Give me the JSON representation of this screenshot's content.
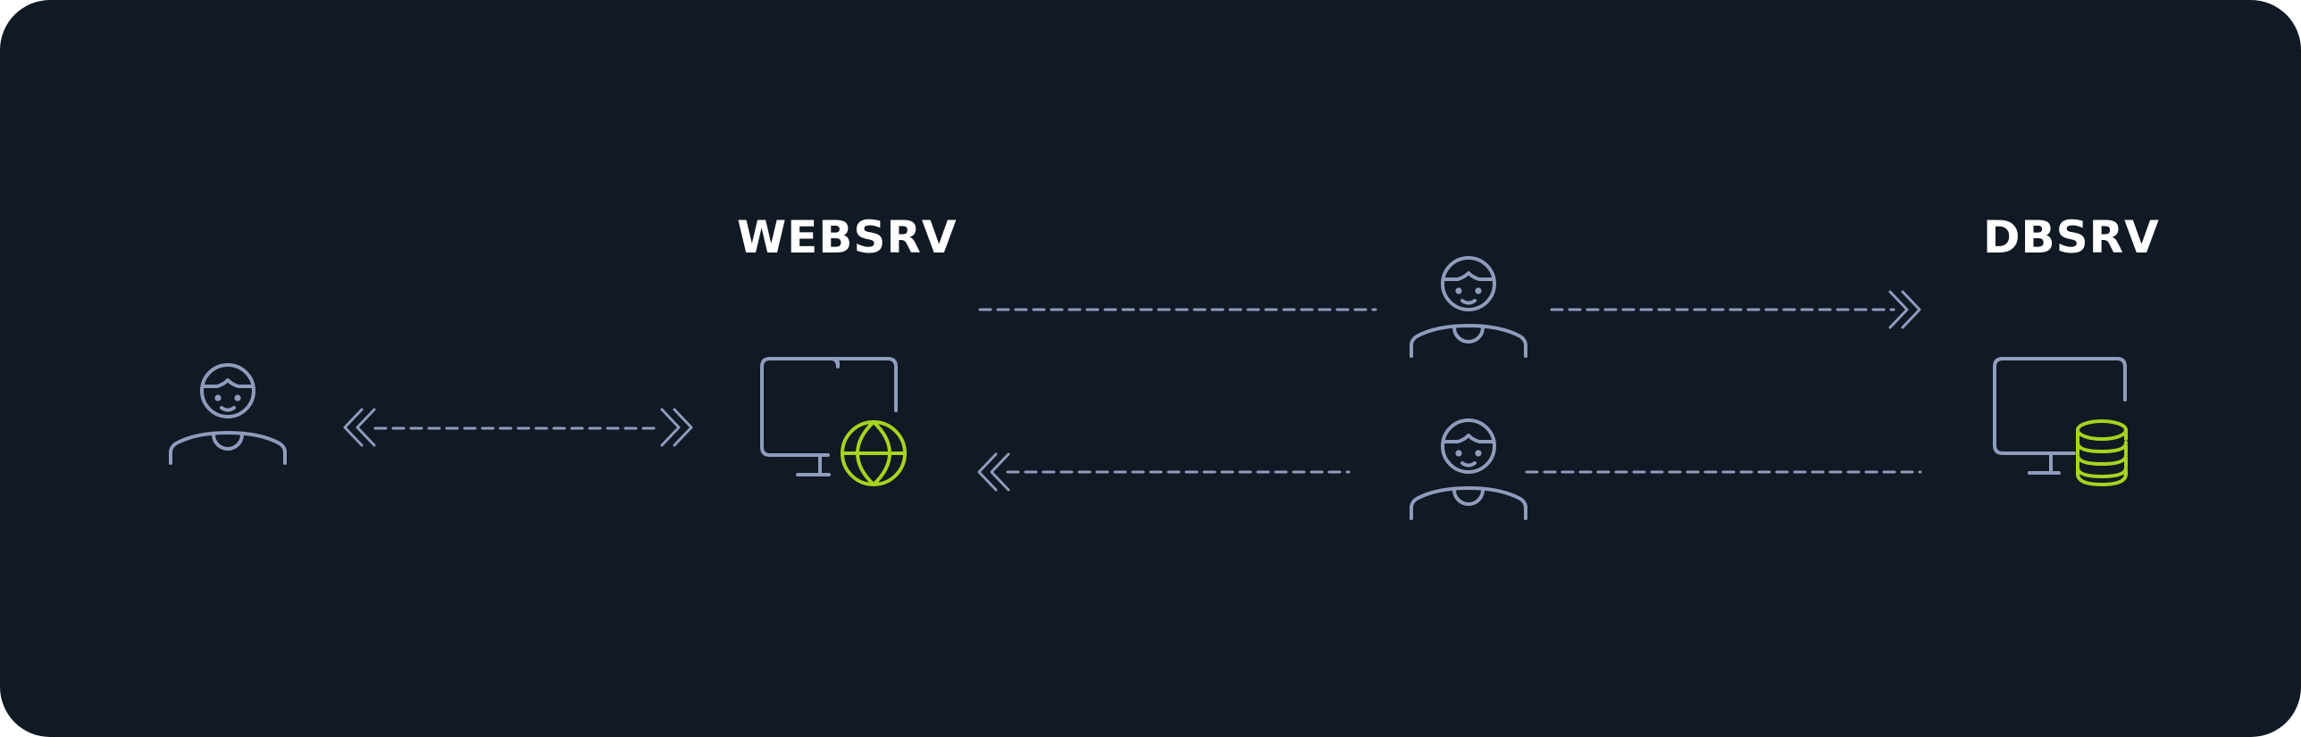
{
  "diagram": {
    "labels": {
      "web_server": "WEBSRV",
      "db_server": "DBSRV"
    },
    "icons": {
      "client": "person-icon",
      "attacker_top": "person-icon",
      "attacker_bottom": "person-icon",
      "web_server": "monitor-globe-icon",
      "db_server": "monitor-database-icon"
    },
    "colors": {
      "background": "#111925",
      "stroke": "#8f9cbc",
      "accent": "#a6d41f",
      "label": "#ffffff"
    }
  }
}
